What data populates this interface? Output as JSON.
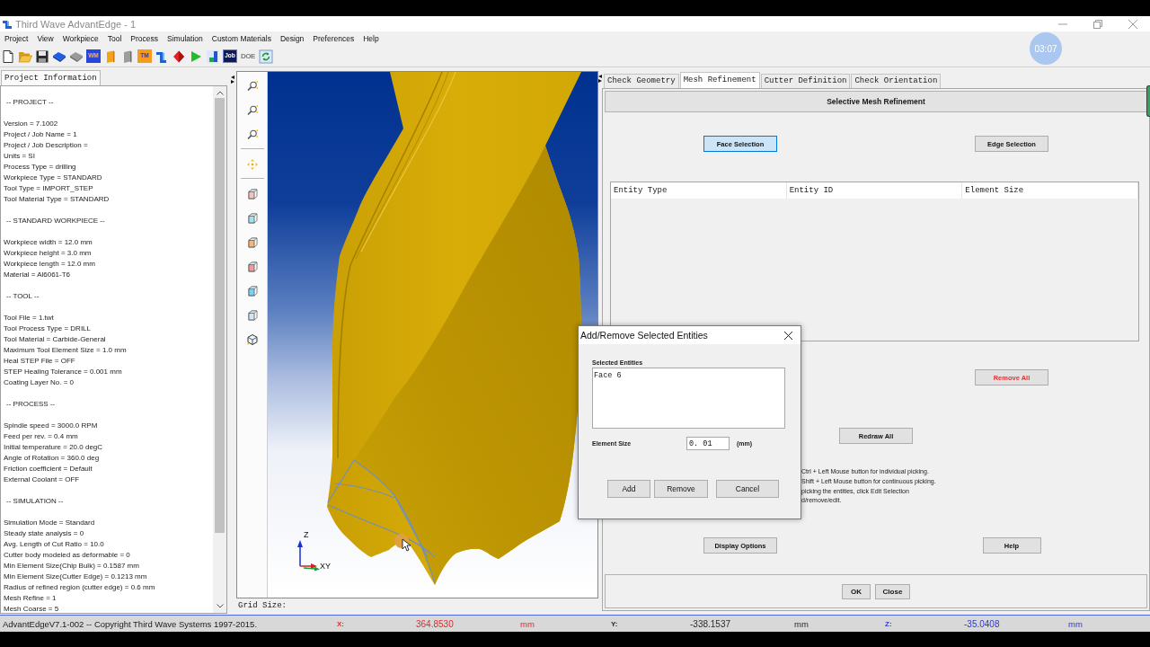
{
  "window": {
    "title": "Third Wave AdvantEdge - 1"
  },
  "timer_badge": "03:07",
  "menu": [
    "Project",
    "View",
    "Workpiece",
    "Tool",
    "Process",
    "Simulation",
    "Custom Materials",
    "Design",
    "Preferences",
    "Help"
  ],
  "toolbar": [
    {
      "kind": "new"
    },
    {
      "kind": "open"
    },
    {
      "kind": "save"
    },
    {
      "kind": "block"
    },
    {
      "kind": "disc"
    },
    {
      "kind": "tileblue",
      "label": "WM"
    },
    {
      "kind": "orangebar"
    },
    {
      "kind": "graybar"
    },
    {
      "kind": "tileorange",
      "label": "TM"
    },
    {
      "kind": "bracket"
    },
    {
      "kind": "diamond"
    },
    {
      "kind": "play"
    },
    {
      "kind": "chart"
    },
    {
      "kind": "tiledark",
      "label": "Job"
    },
    {
      "kind": "doe",
      "label": "DOE"
    },
    {
      "kind": "refresh"
    }
  ],
  "project_info": {
    "tab": "Project Information",
    "sections": [
      {
        "heading": "-- PROJECT --",
        "lines": [
          "Version = 7.1002",
          "Project / Job Name = 1",
          "Project / Job Description =",
          "Units = SI",
          "Process Type = drilling",
          "Workpiece Type = STANDARD",
          "Tool Type = IMPORT_STEP",
          "Tool Material Type = STANDARD"
        ]
      },
      {
        "heading": "-- STANDARD WORKPIECE --",
        "lines": [
          "Workpiece width = 12.0 mm",
          "Workpiece height = 3.0 mm",
          "Workpiece length = 12.0 mm",
          "Material = Al6061-T6"
        ]
      },
      {
        "heading": "-- TOOL --",
        "lines": [
          "Tool File = 1.twt",
          "Tool Process Type = DRILL",
          "Tool Material = Carbide-General",
          "Maximum Tool Element Size = 1.0 mm",
          "Heal STEP File = OFF",
          "STEP Healing Tolerance = 0.001 mm",
          "Coating Layer No. = 0"
        ]
      },
      {
        "heading": "-- PROCESS --",
        "lines": [
          "Spindle speed = 3000.0 RPM",
          "Feed per rev. = 0.4 mm",
          "Initial temperature = 20.0 degC",
          "Angle of Rotation = 360.0 deg",
          "Friction coefficient = Default",
          "External Coolant = OFF"
        ]
      },
      {
        "heading": "-- SIMULATION --",
        "lines": [
          "Simulation Mode = Standard",
          "Steady state analysis = 0",
          "Avg. Length of Cut Ratio = 10.0",
          "Cutter body modeled as deformable = 0",
          "Min Element Size(Chip Bulk) = 0.1587 mm",
          "Min Element Size(Cutter Edge) = 0.1213 mm",
          "Radius of refined region (cutter edge) = 0.6 mm",
          "Mesh Refine = 1",
          "Mesh Coarse = 5"
        ]
      }
    ]
  },
  "viewport": {
    "axes": {
      "vertical": "Z",
      "horizontal": "X",
      "depth": "Y"
    },
    "grid_size_label": "Grid Size:"
  },
  "tabs": [
    {
      "label": "Check Geometry",
      "selected": false
    },
    {
      "label": "Mesh Refinement",
      "selected": true
    },
    {
      "label": "Cutter Definition",
      "selected": false
    },
    {
      "label": "Check Orientation",
      "selected": false
    }
  ],
  "mesh_refinement": {
    "header": "Selective Mesh Refinement",
    "selection_buttons": [
      {
        "label": "Face Selection",
        "selected": true
      },
      {
        "label": "Edge Selection",
        "selected": false
      }
    ],
    "table": {
      "columns": [
        "Entity Type",
        "Entity ID",
        "Element Size"
      ]
    },
    "remove_all": "Remove All",
    "redraw_all": "Redraw All",
    "instructions": [
      "Ctrl + Left Mouse button for individual picking.",
      "Shift + Left Mouse button for continuous picking.",
      "picking the entities, click Edit Selection",
      "d/remove/edit."
    ],
    "buttons": [
      "Display Options",
      "Help"
    ]
  },
  "footer_buttons": [
    "OK",
    "Close"
  ],
  "dialog": {
    "title": "Add/Remove Selected Entities",
    "list_label": "Selected Entities",
    "list_items": [
      "Face 6"
    ],
    "size_label": "Element Size",
    "size_value": "0. 01",
    "unit": "(mm)",
    "buttons": [
      "Add",
      "Remove",
      "Cancel"
    ]
  },
  "status_bar": {
    "copyright": "AdvantEdgeV7.1-002 -- Copyright Third Wave Systems 1997-2015.",
    "coordinates": [
      {
        "axis": "X:",
        "value": "364.8530",
        "unit": "mm",
        "color": "#e52a2a"
      },
      {
        "axis": "Y:",
        "value": "-338.1537",
        "unit": "mm",
        "color": "#2a2a2a"
      },
      {
        "axis": "Z:",
        "value": "-35.0408",
        "unit": "mm",
        "color": "#2b3bd6"
      }
    ]
  }
}
